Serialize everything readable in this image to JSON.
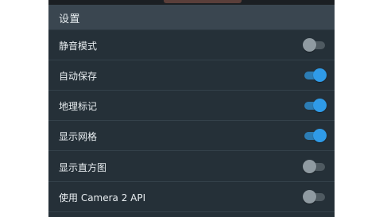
{
  "settings_panel": {
    "title": "设置",
    "accent_color": "#2f9be8",
    "items": [
      {
        "label": "静音模式",
        "enabled": false
      },
      {
        "label": "自动保存",
        "enabled": true
      },
      {
        "label": "地理标记",
        "enabled": true
      },
      {
        "label": "显示网格",
        "enabled": true
      },
      {
        "label": "显示直方图",
        "enabled": false
      },
      {
        "label": "使用 Camera 2 API",
        "enabled": false
      }
    ]
  }
}
